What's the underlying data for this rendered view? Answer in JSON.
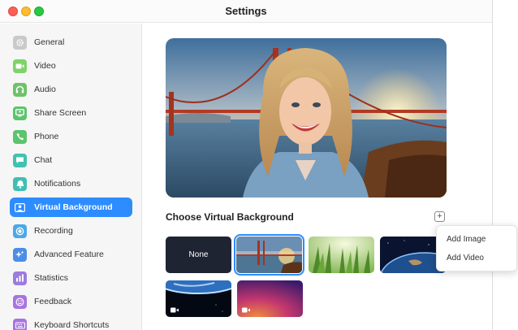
{
  "window": {
    "title": "Settings"
  },
  "sidebar": {
    "items": [
      {
        "label": "General",
        "icon": "gear-icon",
        "color": "#c9c9c9",
        "active": false
      },
      {
        "label": "Video",
        "icon": "camera-icon",
        "color": "#7ed36a",
        "active": false
      },
      {
        "label": "Audio",
        "icon": "headphones-icon",
        "color": "#6ec26a",
        "active": false
      },
      {
        "label": "Share Screen",
        "icon": "share-screen-icon",
        "color": "#5cc46c",
        "active": false
      },
      {
        "label": "Phone",
        "icon": "phone-icon",
        "color": "#5cc46c",
        "active": false
      },
      {
        "label": "Chat",
        "icon": "chat-icon",
        "color": "#41c2b0",
        "active": false
      },
      {
        "label": "Notifications",
        "icon": "bell-icon",
        "color": "#3fbfb2",
        "active": false
      },
      {
        "label": "Virtual Background",
        "icon": "person-icon",
        "color": "#ffffff",
        "active": true
      },
      {
        "label": "Recording",
        "icon": "record-icon",
        "color": "#4aa9e8",
        "active": false
      },
      {
        "label": "Advanced Feature",
        "icon": "sparkle-icon",
        "color": "#4a8ee8",
        "active": false
      },
      {
        "label": "Statistics",
        "icon": "chart-icon",
        "color": "#9d7be0",
        "active": false
      },
      {
        "label": "Feedback",
        "icon": "smiley-icon",
        "color": "#a874e0",
        "active": false
      },
      {
        "label": "Keyboard Shortcuts",
        "icon": "keyboard-icon",
        "color": "#a874e0",
        "active": false
      }
    ]
  },
  "main": {
    "section_title": "Choose Virtual Background",
    "add_button": "+",
    "thumbnails": [
      {
        "label": "None",
        "kind": "none",
        "selected": false
      },
      {
        "label": "",
        "kind": "golden-gate",
        "selected": true
      },
      {
        "label": "",
        "kind": "grass",
        "selected": false
      },
      {
        "label": "",
        "kind": "earth",
        "selected": false
      },
      {
        "label": "",
        "kind": "earth-horizon-video",
        "selected": false
      },
      {
        "label": "",
        "kind": "purple-video",
        "selected": false
      }
    ]
  },
  "popup": {
    "items": [
      "Add Image",
      "Add Video"
    ]
  },
  "colors": {
    "accent": "#2d8cff"
  }
}
